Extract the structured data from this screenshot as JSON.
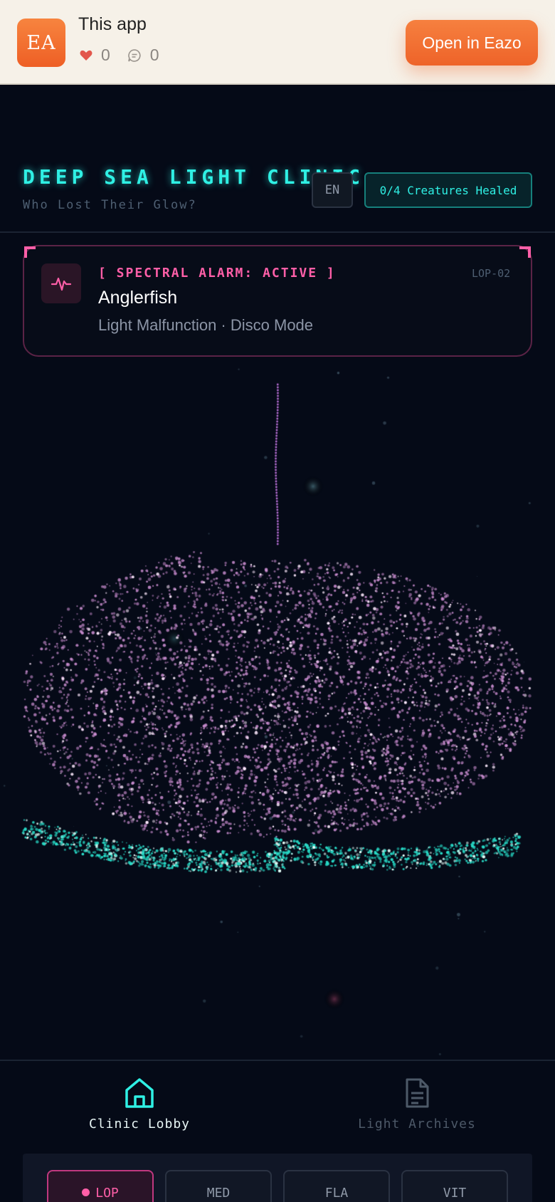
{
  "promo": {
    "logo_text": "EA",
    "title": "This app",
    "likes": "0",
    "comments": "0",
    "open_button": "Open in Eazo"
  },
  "header": {
    "title": "DEEP SEA LIGHT CLINIC",
    "subtitle": "Who Lost Their Glow?",
    "language": "EN",
    "healed_status": "0/4 Creatures Healed"
  },
  "alarm": {
    "status": "[ SPECTRAL ALARM: ACTIVE ]",
    "code": "LOP-02",
    "creature_name": "Anglerfish",
    "description": "Light Malfunction · Disco Mode"
  },
  "nav": {
    "lobby_label": "Clinic Lobby",
    "archives_label": "Light Archives"
  },
  "tabs": [
    {
      "label": "LOP"
    },
    {
      "label": "MED"
    },
    {
      "label": "FLA"
    },
    {
      "label": "VIT"
    }
  ],
  "colors": {
    "accent_cyan": "#2ff0e4",
    "accent_pink": "#ff5fa8",
    "brand_orange": "#ee6329",
    "background": "#050a17"
  }
}
